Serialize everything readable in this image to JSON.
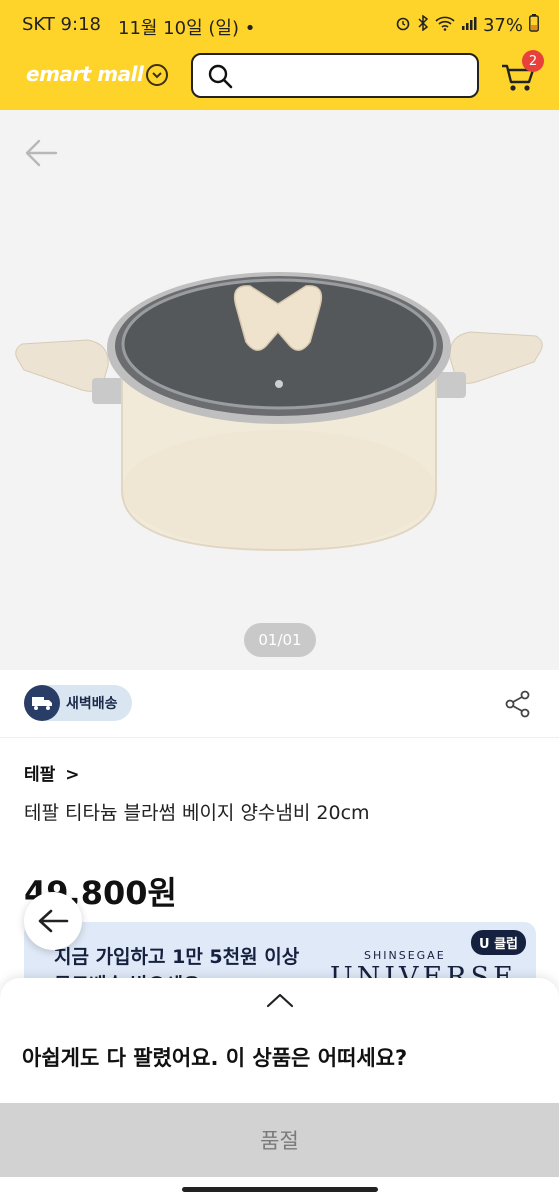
{
  "status_bar": {
    "time": "SKT 9:18",
    "date": "11월 10일 (일) •",
    "battery": "37%"
  },
  "header": {
    "logo_text": "emart mall",
    "cart_count": "2",
    "search_icon": "search-icon",
    "cart_icon": "cart-icon",
    "accent": "#ffd42a"
  },
  "gallery": {
    "counter": "01/01",
    "back_icon": "arrow-left-icon"
  },
  "product": {
    "delivery_badge": "새벽배송",
    "brand": "테팔",
    "brand_chevron": ">",
    "name": "테팔 티타늄 블라썸 베이지 양수냄비 20cm",
    "price": "49,800원"
  },
  "banner": {
    "line1": "지금 가입하고 1만 5천원 이상",
    "line2": "무료배송 받으세요",
    "brand_small": "SHINSEGAE",
    "brand_large": "UNIVERSE",
    "badge": "U 클럽"
  },
  "sheet": {
    "message": "아쉽게도 다 팔렸어요. 이 상품은 어떠세요?",
    "soldout_button": "품절"
  }
}
